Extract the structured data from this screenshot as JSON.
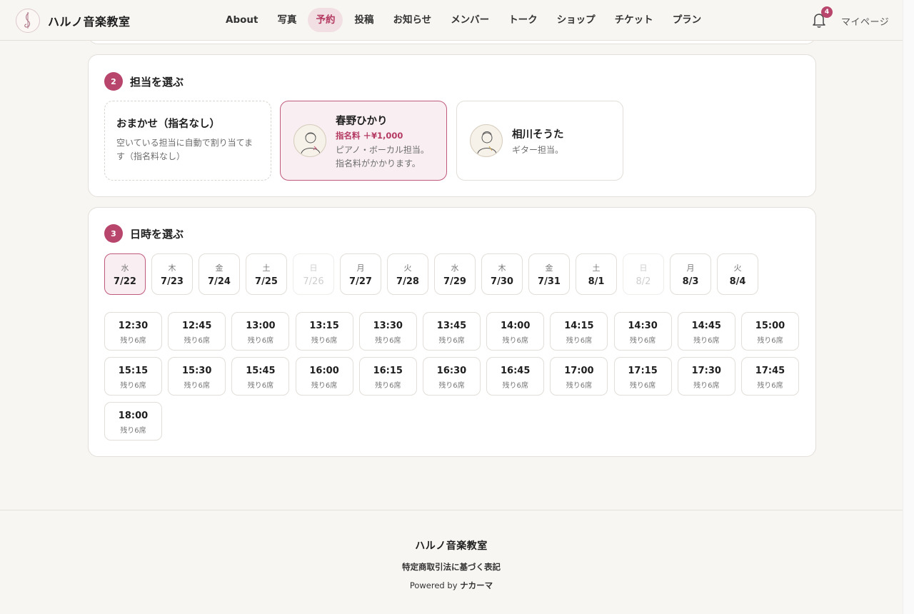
{
  "header": {
    "brand": "ハルノ音楽教室",
    "nav": [
      "About",
      "写真",
      "予約",
      "投稿",
      "お知らせ",
      "メンバー",
      "トーク",
      "ショップ",
      "チケット",
      "プラン"
    ],
    "active_nav": "予約",
    "notification_count": "4",
    "mypage": "マイページ"
  },
  "staff_section": {
    "step": "2",
    "title": "担当を選ぶ",
    "options": [
      {
        "name": "おまかせ（指名なし）",
        "desc": "空いている担当に自動で割り当てます（指名料なし）"
      },
      {
        "name": "春野ひかり",
        "fee": "指名料 ＋¥1,000",
        "desc": "ピアノ・ボーカル担当。指名料がかかります。"
      },
      {
        "name": "相川そうた",
        "desc": "ギター担当。"
      }
    ]
  },
  "date_section": {
    "step": "3",
    "title": "日時を選ぶ",
    "dates": [
      {
        "dow": "水",
        "md": "7/22"
      },
      {
        "dow": "木",
        "md": "7/23"
      },
      {
        "dow": "金",
        "md": "7/24"
      },
      {
        "dow": "土",
        "md": "7/25"
      },
      {
        "dow": "日",
        "md": "7/26"
      },
      {
        "dow": "月",
        "md": "7/27"
      },
      {
        "dow": "火",
        "md": "7/28"
      },
      {
        "dow": "水",
        "md": "7/29"
      },
      {
        "dow": "木",
        "md": "7/30"
      },
      {
        "dow": "金",
        "md": "7/31"
      },
      {
        "dow": "土",
        "md": "8/1"
      },
      {
        "dow": "日",
        "md": "8/2"
      },
      {
        "dow": "月",
        "md": "8/3"
      },
      {
        "dow": "火",
        "md": "8/4"
      }
    ],
    "slots": [
      {
        "time": "12:30",
        "remain": "残り6席"
      },
      {
        "time": "12:45",
        "remain": "残り6席"
      },
      {
        "time": "13:00",
        "remain": "残り6席"
      },
      {
        "time": "13:15",
        "remain": "残り6席"
      },
      {
        "time": "13:30",
        "remain": "残り6席"
      },
      {
        "time": "13:45",
        "remain": "残り6席"
      },
      {
        "time": "14:00",
        "remain": "残り6席"
      },
      {
        "time": "14:15",
        "remain": "残り6席"
      },
      {
        "time": "14:30",
        "remain": "残り6席"
      },
      {
        "time": "14:45",
        "remain": "残り6席"
      },
      {
        "time": "15:00",
        "remain": "残り6席"
      },
      {
        "time": "15:15",
        "remain": "残り6席"
      },
      {
        "time": "15:30",
        "remain": "残り6席"
      },
      {
        "time": "15:45",
        "remain": "残り6席"
      },
      {
        "time": "16:00",
        "remain": "残り6席"
      },
      {
        "time": "16:15",
        "remain": "残り6席"
      },
      {
        "time": "16:30",
        "remain": "残り6席"
      },
      {
        "time": "16:45",
        "remain": "残り6席"
      },
      {
        "time": "17:00",
        "remain": "残り6席"
      },
      {
        "time": "17:15",
        "remain": "残り6席"
      },
      {
        "time": "17:30",
        "remain": "残り6席"
      },
      {
        "time": "17:45",
        "remain": "残り6席"
      },
      {
        "time": "18:00",
        "remain": "残り6席"
      }
    ]
  },
  "footer": {
    "name": "ハルノ音楽教室",
    "law": "特定商取引法に基づく表記",
    "powered_prefix": "Powered by",
    "powered_brand": "ナカーマ"
  },
  "colors": {
    "accent": "#b8456b",
    "selected_bg": "#f9eef1",
    "page_bg": "#f8f6f2"
  }
}
